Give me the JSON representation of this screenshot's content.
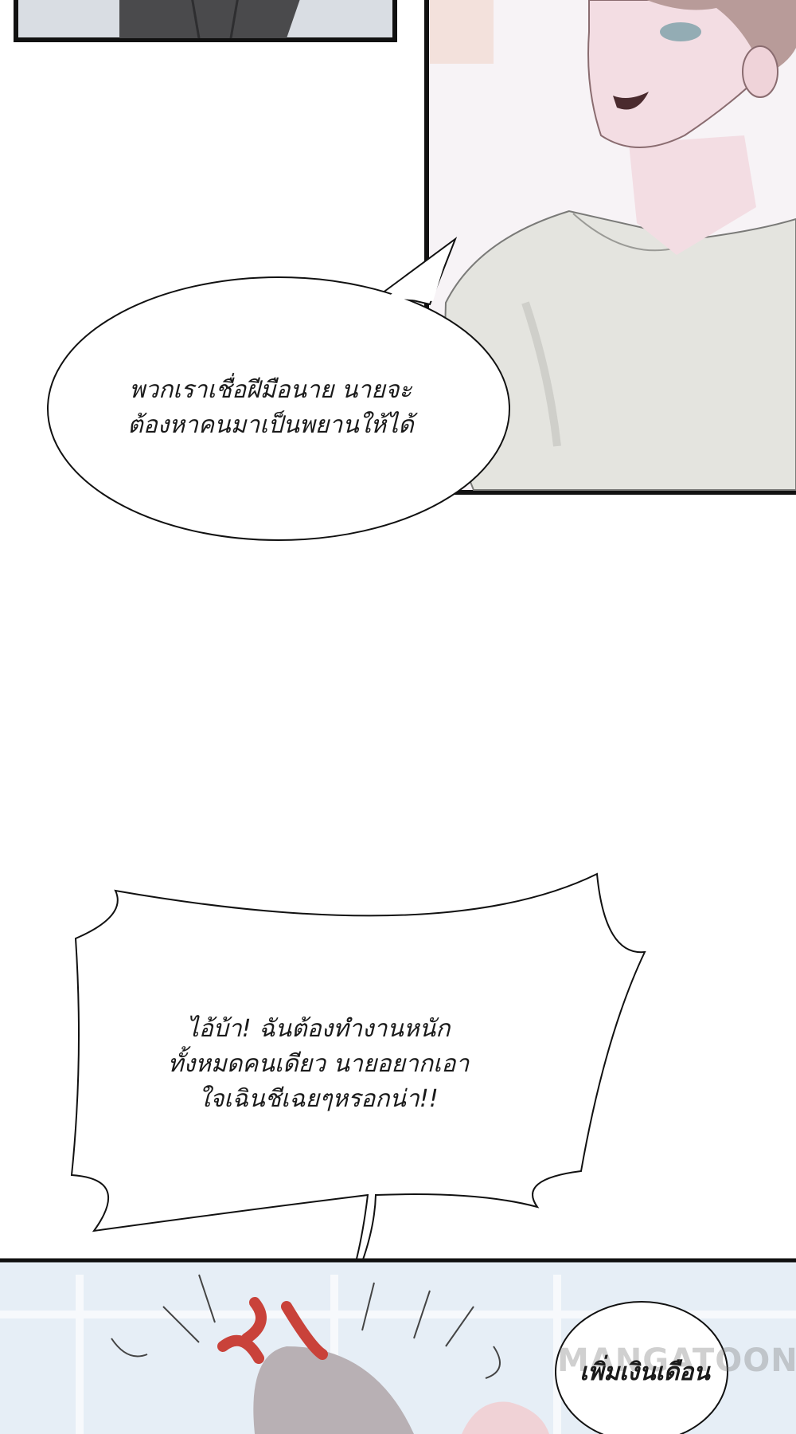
{
  "bubble_1": {
    "line_1": "พวกเราเชื่อฝีมือนาย นายจะ",
    "line_2": "ต้องหาคนมาเป็นพยานให้ได้"
  },
  "bubble_2": {
    "line_1": "ไอ้บ้า! ฉันต้องทำงานหนัก",
    "line_2": "ทั้งหมดคนเดียว นายอยากเอา",
    "line_3": "ใจเฉินชีเฉยๆหรอกน่า!!"
  },
  "bubble_3": {
    "line_1": "เพิ่มเงินเดือน"
  },
  "watermark": "MANGATOON",
  "colors": {
    "panel_border": "#111111",
    "shirt": "#e4e4df",
    "skin": "#f3dde3",
    "hair": "#b89b99",
    "anger_mark": "#c9423a",
    "pale_blue_bg": "#e6eef6"
  }
}
